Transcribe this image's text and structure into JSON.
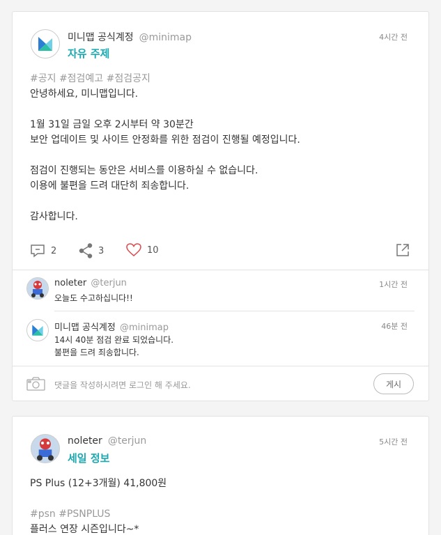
{
  "posts": [
    {
      "author": "미니맵 공식계정",
      "handle": "@minimap",
      "topic": "자유 주제",
      "time": "4시간 전",
      "tags": "#공지 #점검예고 #점검공지",
      "lines": [
        "안녕하세요, 미니맵입니다.",
        "",
        "1월 31일 금일 오후 2시부터 약 30분간",
        "보안 업데이트 및 사이트 안정화를 위한 점검이 진행될 예정입니다.",
        "",
        "점검이 진행되는 동안은 서비스를 이용하실 수 없습니다.",
        "이용에 불편을 드려 대단히 죄송합니다.",
        "",
        "감사합니다."
      ],
      "comment_count": "2",
      "share_count": "3",
      "like_count": "10",
      "comments": [
        {
          "author": "noleter",
          "handle": "@terjun",
          "time": "1시간 전",
          "lines": [
            "오늘도 수고하십니다!!"
          ]
        },
        {
          "author": "미니맵 공식계정",
          "handle": "@minimap",
          "time": "46분 전",
          "lines": [
            "14시 40분 점검 완료 되었습니다.",
            "불편을 드려 죄송합니다."
          ]
        }
      ],
      "composer_placeholder": "댓글을 작성하시려면 로그인 해 주세요.",
      "post_button": "게시"
    },
    {
      "author": "noleter",
      "handle": "@terjun",
      "topic": "세일 정보",
      "time": "5시간 전",
      "line1": "PS Plus (12+3개월) 41,800원",
      "tags": "#psn #PSNPLUS",
      "line2": "플러스 연장 시즌입니다~*"
    }
  ],
  "colors": {
    "accent": "#1ca8b0",
    "like": "#e0474c"
  },
  "icons": [
    "minimap-logo-icon",
    "comment-icon",
    "share-icon",
    "heart-icon",
    "external-link-icon",
    "camera-icon"
  ]
}
